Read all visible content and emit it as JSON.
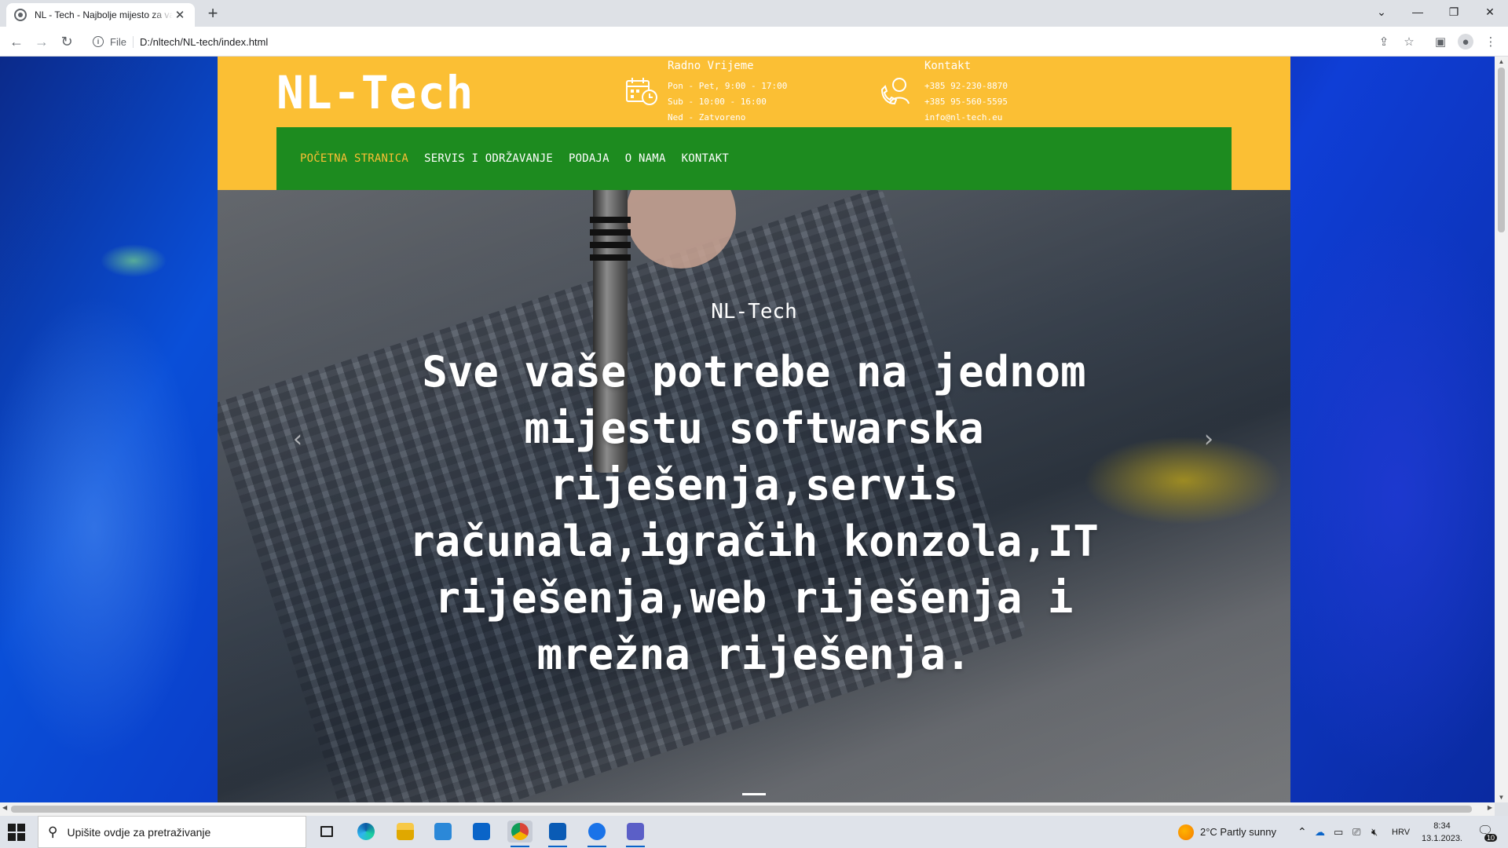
{
  "browser": {
    "tab_title": "NL - Tech - Najbolje mijesto za vaše potrebe",
    "tab_close": "✕",
    "new_tab": "+",
    "window_controls": [
      "⌄",
      "—",
      "❐",
      "✕"
    ],
    "back": "←",
    "forward": "→",
    "reload": "↻",
    "scheme": "File",
    "url": "D:/nltech/NL-tech/index.html",
    "toolbar_icons": [
      "share-icon",
      "star-icon",
      "side-panel-icon",
      "profile-icon",
      "menu-icon"
    ]
  },
  "site": {
    "brand": "NL-Tech",
    "hours": {
      "title": "Radno Vrijeme",
      "lines": [
        "Pon - Pet, 9:00 - 17:00",
        "Sub - 10:00 - 16:00",
        "Ned - Zatvoreno"
      ]
    },
    "contact": {
      "title": "Kontakt",
      "lines": [
        "+385 92-230-8870",
        "+385 95-560-5595",
        "info@nl-tech.eu"
      ]
    },
    "nav": [
      "POČETNA STRANICA",
      "SERVIS I ODRŽAVANJE",
      "PODAJA",
      "O NAMA",
      "KONTAKT"
    ],
    "active_nav_index": 0,
    "hero": {
      "subtitle": "NL-Tech",
      "title": "Sve vaše potrebe na jednom mijestu softwarska riješenja,servis računala,igračih konzola,IT riješenja,web riješenja i mrežna riješenja.",
      "prev": "‹",
      "next": "›"
    },
    "colors": {
      "header": "#fbbf34",
      "nav": "#1d8b1f",
      "active": "#fbbf34"
    }
  },
  "taskbar": {
    "search_placeholder": "Upišite ovdje za pretraživanje",
    "apps": [
      "task-view-icon",
      "edge-icon",
      "file-explorer-icon",
      "store-icon",
      "mail-icon",
      "chrome-icon",
      "outlook-icon",
      "teamviewer-icon",
      "teams-icon"
    ],
    "weather": "2°C  Partly sunny",
    "language": "HRV",
    "time": "8:34",
    "date": "13.1.2023.",
    "notifications": "10"
  }
}
